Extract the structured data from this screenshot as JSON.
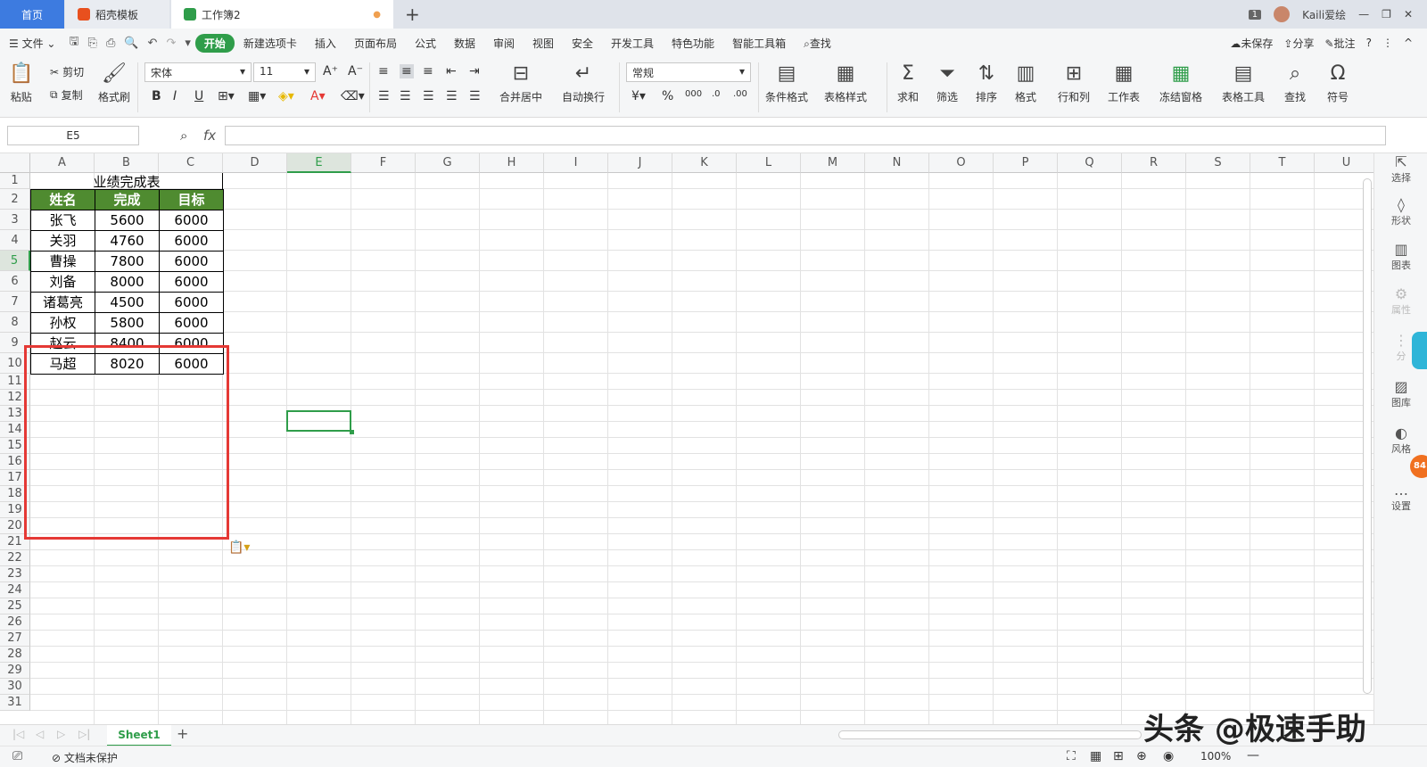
{
  "tabs": [
    {
      "label": "首页"
    },
    {
      "label": "稻壳模板"
    },
    {
      "label": "工作簿2"
    }
  ],
  "window": {
    "badge": "1",
    "user": "Kaili爱绘"
  },
  "menu": {
    "file": "文件",
    "items": [
      "开始",
      "新建选项卡",
      "插入",
      "页面布局",
      "公式",
      "数据",
      "审阅",
      "视图",
      "安全",
      "开发工具",
      "特色功能",
      "智能工具箱"
    ],
    "search": "查找",
    "unsaved": "未保存",
    "share": "分享",
    "comment": "批注"
  },
  "ribbon": {
    "paste": "粘贴",
    "cut": "剪切",
    "copy": "复制",
    "format_painter": "格式刷",
    "font_name": "宋体",
    "font_size": "11",
    "merge": "合并居中",
    "wrap": "自动换行",
    "number_format": "常规",
    "cond_format": "条件格式",
    "table_style": "表格样式",
    "sum": "求和",
    "filter": "筛选",
    "sort": "排序",
    "format": "格式",
    "row_col": "行和列",
    "worksheet": "工作表",
    "freeze": "冻结窗格",
    "table_tools": "表格工具",
    "find": "查找",
    "symbol": "符号"
  },
  "formula_bar": {
    "name_box": "E5",
    "fx": "fx",
    "value": ""
  },
  "columns": [
    "A",
    "B",
    "C",
    "D",
    "E",
    "F",
    "G",
    "H",
    "I",
    "J",
    "K",
    "L",
    "M",
    "N",
    "O",
    "P",
    "Q",
    "R",
    "S",
    "T",
    "U"
  ],
  "rows": [
    "1",
    "2",
    "3",
    "4",
    "5",
    "6",
    "7",
    "8",
    "9",
    "10",
    "11",
    "12",
    "13",
    "14",
    "15",
    "16",
    "17",
    "18",
    "19",
    "20",
    "21",
    "22",
    "23",
    "24",
    "25",
    "26",
    "27",
    "28",
    "29",
    "30",
    "31"
  ],
  "sheet": {
    "title": "业绩完成表",
    "headers": [
      "姓名",
      "完成",
      "目标"
    ],
    "data": [
      [
        "张飞",
        "5600",
        "6000"
      ],
      [
        "关羽",
        "4760",
        "6000"
      ],
      [
        "曹操",
        "7800",
        "6000"
      ],
      [
        "刘备",
        "8000",
        "6000"
      ],
      [
        "诸葛亮",
        "4500",
        "6000"
      ],
      [
        "孙权",
        "5800",
        "6000"
      ],
      [
        "赵云",
        "8400",
        "6000"
      ],
      [
        "马超",
        "8020",
        "6000"
      ]
    ]
  },
  "sidebar": [
    "选择",
    "形状",
    "图表",
    "属性",
    "分",
    "图库",
    "风格",
    "设置"
  ],
  "sidebar_badge": "84",
  "sheet_tabs": [
    "Sheet1"
  ],
  "status": {
    "protect": "文档未保护",
    "zoom": "100%"
  },
  "watermark": "头条 @极速手助",
  "colors": {
    "accent": "#2f9d4a",
    "header_fill": "#4f8b30",
    "highlight": "#e53935",
    "home_tab": "#3d7be0"
  }
}
